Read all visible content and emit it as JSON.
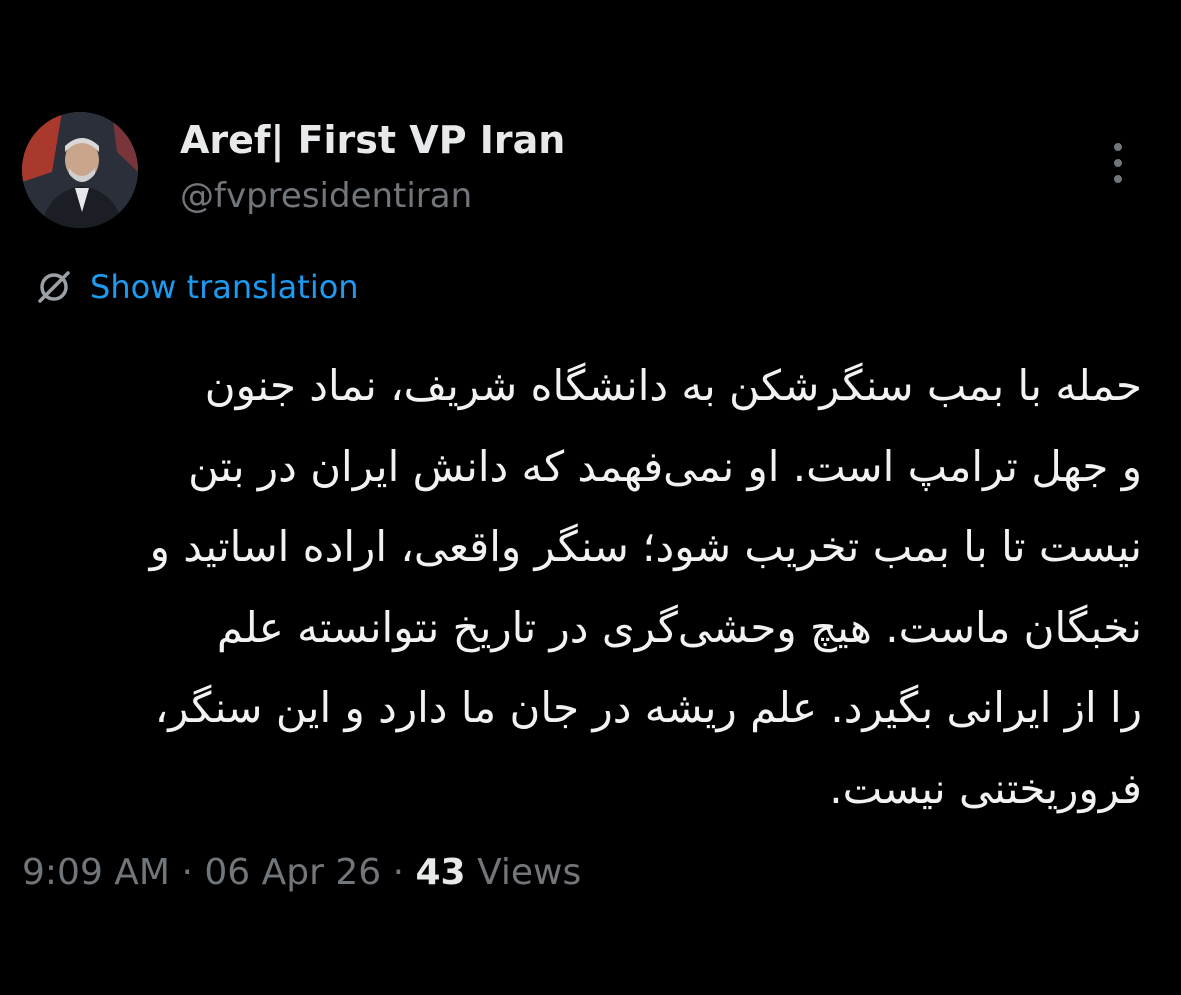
{
  "author": {
    "display_name": "Aref| First VP Iran",
    "handle": "@fvpresidentiran",
    "avatar_icon": "profile-photo"
  },
  "actions": {
    "more_icon": "vertical-ellipsis-icon",
    "translation_icon": "translate-globe-slash-icon",
    "show_translation_label": "Show translation"
  },
  "tweet": {
    "lines": [
      "حمله با بمب سنگرشکن به دانشگاه شریف، نماد جنون",
      "و جهل ترامپ است. او نمی‌فهمد که دانش ایران در بتن",
      "نیست تا با بمب تخریب شود؛ سنگر واقعی، اراده اساتید و",
      "نخبگان ماست. هیچ وحشی‌گری  در تاریخ نتوانسته علم",
      "را از ایرانی بگیرد. علم ریشه در جان ما دارد و این سنگر،",
      "فروریختنی نیست."
    ]
  },
  "meta": {
    "time": "9:09 AM",
    "separator": "·",
    "date": "06 Apr 26",
    "views_count": "43",
    "views_label": "Views"
  },
  "colors": {
    "background": "#000000",
    "primary_text": "#e7e9ea",
    "secondary_text": "#71767b",
    "link": "#1d9bf0"
  }
}
